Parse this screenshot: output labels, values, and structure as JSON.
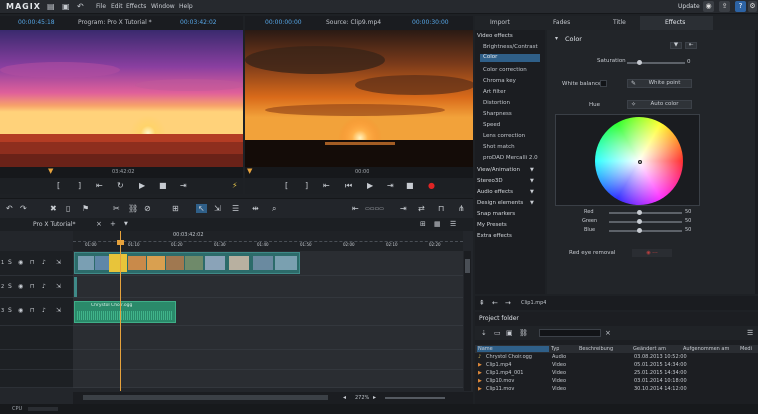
{
  "app": {
    "logo": "MAGIX",
    "update_label": "Update"
  },
  "menu": [
    "File",
    "Edit",
    "Effects",
    "Window",
    "Help"
  ],
  "program_monitor": {
    "timecode": "00:00:45:18",
    "title": "Program: Pro X Tutorial *",
    "timecode_right": "00:03:42:02",
    "position_label": "03:42:02"
  },
  "source_monitor": {
    "timecode": "00:00:00:00",
    "title": "Source: Clip9.mp4",
    "timecode_right": "00:00:30:00",
    "position_label": "00:00"
  },
  "timeline": {
    "project_tab": "Pro X Tutorial*",
    "ruler_time": "00:03:42:02",
    "zoom": "272%",
    "ruler_marks": [
      "01:00",
      "01:10",
      "01:20",
      "01:30",
      "01:40",
      "01:50",
      "02:00",
      "02:10",
      "02:20"
    ]
  },
  "right_tabs": [
    "Import",
    "Fades",
    "Title",
    "Effects"
  ],
  "effects_nav": {
    "items": [
      {
        "label": "Video effects",
        "type": "section"
      },
      {
        "label": "Brightness/Contrast",
        "type": "item"
      },
      {
        "label": "Color",
        "type": "selected"
      },
      {
        "label": "Color correction",
        "type": "item"
      },
      {
        "label": "Chroma key",
        "type": "item"
      },
      {
        "label": "Art filter",
        "type": "item"
      },
      {
        "label": "Distortion",
        "type": "item"
      },
      {
        "label": "Sharpness",
        "type": "item"
      },
      {
        "label": "Speed",
        "type": "item"
      },
      {
        "label": "Lens correction",
        "type": "item"
      },
      {
        "label": "Shot match",
        "type": "item"
      },
      {
        "label": "proDAD Mercalli 2.0",
        "type": "item"
      },
      {
        "label": "View/Animation",
        "type": "section"
      },
      {
        "label": "Stereo3D",
        "type": "section"
      },
      {
        "label": "Audio effects",
        "type": "section"
      },
      {
        "label": "Design elements",
        "type": "section"
      },
      {
        "label": "Snap markers",
        "type": "section"
      },
      {
        "label": "My Presets",
        "type": "section"
      },
      {
        "label": "Extra effects",
        "type": "section"
      }
    ]
  },
  "color_panel": {
    "title": "Color",
    "saturation_label": "Saturation",
    "saturation_value": "0",
    "white_balance_label": "White balance",
    "white_point_label": "White point",
    "hue_label": "Hue",
    "auto_color_label": "Auto color",
    "red_label": "Red",
    "red_value": "50",
    "green_label": "Green",
    "green_value": "50",
    "blue_label": "Blue",
    "blue_value": "50",
    "red_eye_label": "Red eye removal"
  },
  "project_folder": {
    "breadcrumb": "Clip1.mp4",
    "title": "Project folder",
    "columns": [
      "Name",
      "Typ",
      "Beschreibung",
      "Geändert am",
      "Aufgenommen am",
      "Medi"
    ],
    "rows": [
      {
        "name": "Chrystol Choir.ogg",
        "type": "Audio",
        "modified": "03.08.2013 10:52:00"
      },
      {
        "name": "Clip1.mp4",
        "type": "Video",
        "modified": "05.01.2015 14:34:00"
      },
      {
        "name": "Clip1.mp4_001",
        "type": "Video",
        "modified": "25.01.2015 14:34:00"
      },
      {
        "name": "Clip10.mov",
        "type": "Video",
        "modified": "03.01.2014 10:18:00"
      },
      {
        "name": "Clip11.mov",
        "type": "Video",
        "modified": "30.10.2014 14:12:00"
      }
    ]
  },
  "audio_clip": {
    "label": "Chrystol Choir.ogg"
  },
  "status": {
    "cpu_label": "CPU"
  },
  "colors": {
    "accent": "#2f5f88",
    "timecode": "#56a6e6",
    "record": "#e02424",
    "playhead": "#e6a23c"
  }
}
